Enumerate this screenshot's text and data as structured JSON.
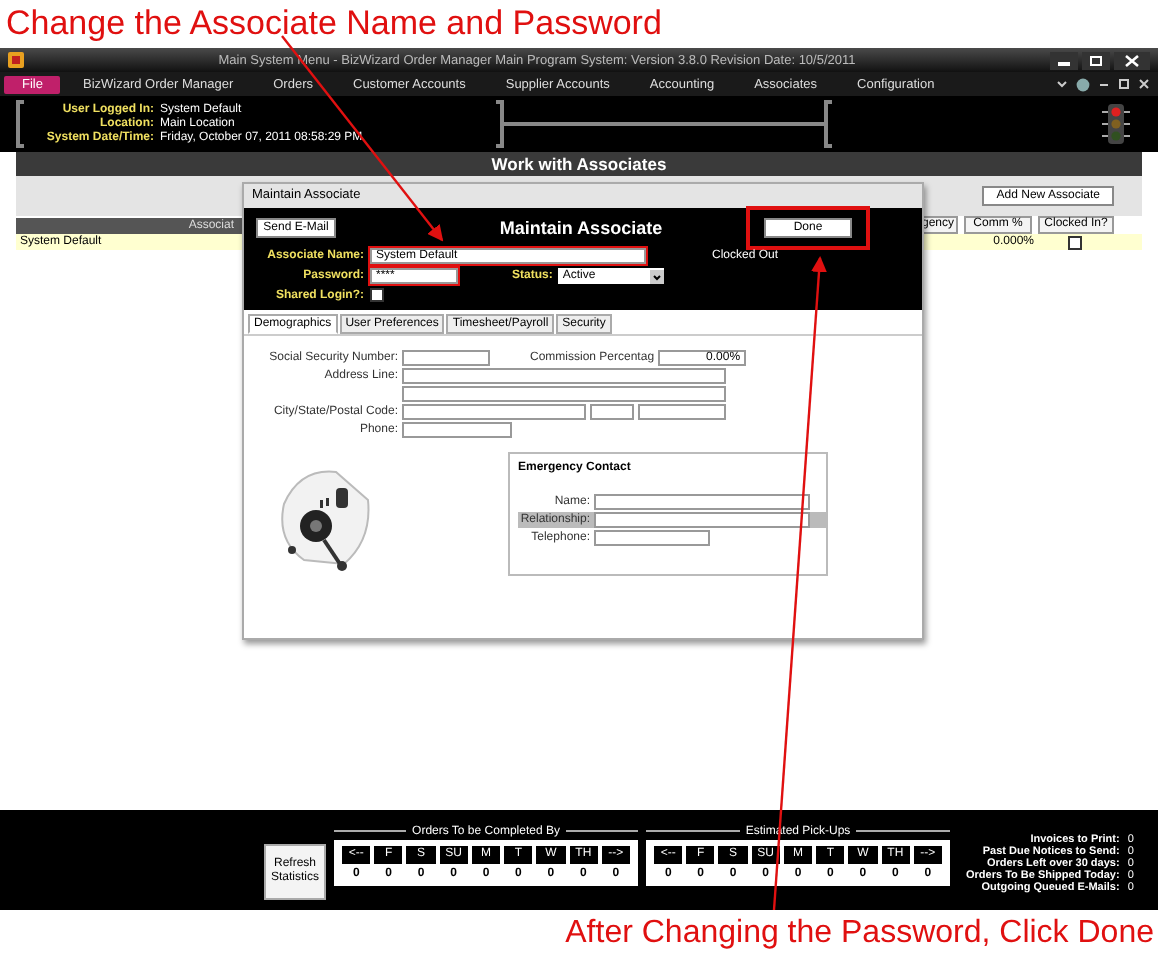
{
  "annotations": {
    "top": "Change the Associate Name and Password",
    "bottom": "After Changing the Password, Click Done"
  },
  "window": {
    "title": "Main System Menu - BizWizard Order Manager Main Program System: Version 3.8.0  Revision Date: 10/5/2011"
  },
  "menu": [
    {
      "label": "File",
      "selected": true
    },
    {
      "label": "BizWizard Order Manager",
      "selected": false
    },
    {
      "label": "Orders",
      "selected": false
    },
    {
      "label": "Customer Accounts",
      "selected": false
    },
    {
      "label": "Supplier Accounts",
      "selected": false
    },
    {
      "label": "Accounting",
      "selected": false
    },
    {
      "label": "Associates",
      "selected": false
    },
    {
      "label": "Configuration",
      "selected": false
    }
  ],
  "session": [
    {
      "label": "User Logged In:",
      "value": "System Default"
    },
    {
      "label": "Location:",
      "value": "Main Location"
    },
    {
      "label": "System Date/Time:",
      "value": "Friday, October 07, 2011   08:58:29 PM"
    }
  ],
  "page_title": "Work with Associates",
  "add_button": "Add New Associate",
  "table": {
    "columns": [
      "Associat",
      "gency",
      "Comm %",
      "Clocked In?"
    ],
    "rows": [
      {
        "name": "System Default",
        "commission": "0.000%",
        "clocked_in": false,
        "selected": true
      }
    ]
  },
  "dialog": {
    "title": "Maintain Associate",
    "heading": "Maintain Associate",
    "send_email": "Send E-Mail",
    "done": {
      "label": "Done",
      "highlighted": true
    },
    "name": {
      "label": "Associate Name:",
      "value": "System Default",
      "highlighted": true
    },
    "password": {
      "label": "Password:",
      "value": "****",
      "highlighted": true
    },
    "status": {
      "label": "Status:",
      "value": "Active"
    },
    "shared": {
      "label": "Shared Login?:",
      "checked": false
    },
    "clock_status": "Clocked Out",
    "tabs": [
      {
        "label": "Demographics",
        "selected": true
      },
      {
        "label": "User Preferences",
        "selected": false
      },
      {
        "label": "Timesheet/Payroll",
        "selected": false
      },
      {
        "label": "Security",
        "selected": false
      }
    ],
    "demographics": {
      "ssn_label": "Social Security Number:",
      "commission_label": "Commission Percentag",
      "commission": "0.00%",
      "address_label": "Address Line:",
      "city_label": "City/State/Postal Code:",
      "phone_label": "Phone:"
    },
    "emergency": {
      "title": "Emergency Contact",
      "fields": [
        {
          "label": "Name:",
          "selected": false
        },
        {
          "label": "Relationship:",
          "selected": true
        },
        {
          "label": "Telephone:",
          "selected": false
        }
      ]
    }
  },
  "stats": {
    "refresh": "Refresh Statistics",
    "groups": [
      {
        "title": "Orders To be Completed By",
        "days": [
          "<--",
          "F",
          "S",
          "SU",
          "M",
          "T",
          "W",
          "TH",
          "-->"
        ],
        "counts": [
          "0",
          "0",
          "0",
          "0",
          "0",
          "0",
          "0",
          "0",
          "0"
        ]
      },
      {
        "title": "Estimated Pick-Ups",
        "days": [
          "<--",
          "F",
          "S",
          "SU",
          "M",
          "T",
          "W",
          "TH",
          "-->"
        ],
        "counts": [
          "0",
          "0",
          "0",
          "0",
          "0",
          "0",
          "0",
          "0",
          "0"
        ]
      }
    ],
    "totals": [
      {
        "label": "Invoices to Print:",
        "value": "0"
      },
      {
        "label": "Past Due Notices to Send:",
        "value": "0"
      },
      {
        "label": "Orders Left over 30 days:",
        "value": "0"
      },
      {
        "label": "Orders To Be Shipped Today:",
        "value": "0"
      },
      {
        "label": "Outgoing Queued E-Mails:",
        "value": "0"
      }
    ]
  }
}
